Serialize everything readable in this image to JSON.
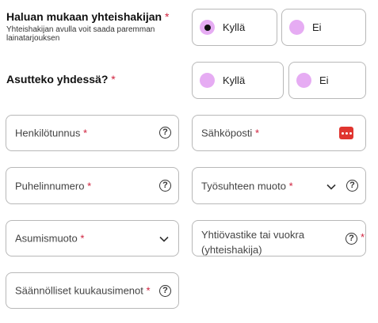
{
  "q1": {
    "label": "Haluan mukaan yhteishakijan",
    "required_mark": "*",
    "help": "Yhteishakijan avulla voit saada paremman lainatarjouksen",
    "options": [
      {
        "label": "Kyllä",
        "selected": true
      },
      {
        "label": "Ei",
        "selected": false
      }
    ]
  },
  "q2": {
    "label": "Asutteko yhdessä?",
    "required_mark": "*",
    "options": [
      {
        "label": "Kyllä",
        "selected": false
      },
      {
        "label": "Ei",
        "selected": false
      }
    ]
  },
  "fields": {
    "henkilotunnus": {
      "label": "Henkilötunnus",
      "required_mark": "*",
      "icon": "question-icon"
    },
    "sahkoposti": {
      "label": "Sähköposti",
      "required_mark": "*",
      "icon": "more-dots-icon"
    },
    "puhelinnumero": {
      "label": "Puhelinnumero",
      "required_mark": "*",
      "icon": "question-icon"
    },
    "tyosuhteen_muoto": {
      "label": "Työsuhteen muoto",
      "required_mark": "*",
      "icon": "chevron-down-icon"
    },
    "asumismuoto": {
      "label": "Asumismuoto",
      "required_mark": "*",
      "icon": "chevron-down-icon"
    },
    "yhtiovastike": {
      "label": "Yhtiövastike tai vuokra (yhteishakija)",
      "required_mark": "*",
      "icon": "question-icon"
    },
    "saannolliset": {
      "label": "Säännölliset kuukausimenot",
      "required_mark": "*",
      "icon": "question-icon"
    }
  },
  "colors": {
    "radio_fill": "#e6acf3",
    "required": "#d0213d",
    "border": "#b8b8b8",
    "error_icon": "#e0352f"
  }
}
